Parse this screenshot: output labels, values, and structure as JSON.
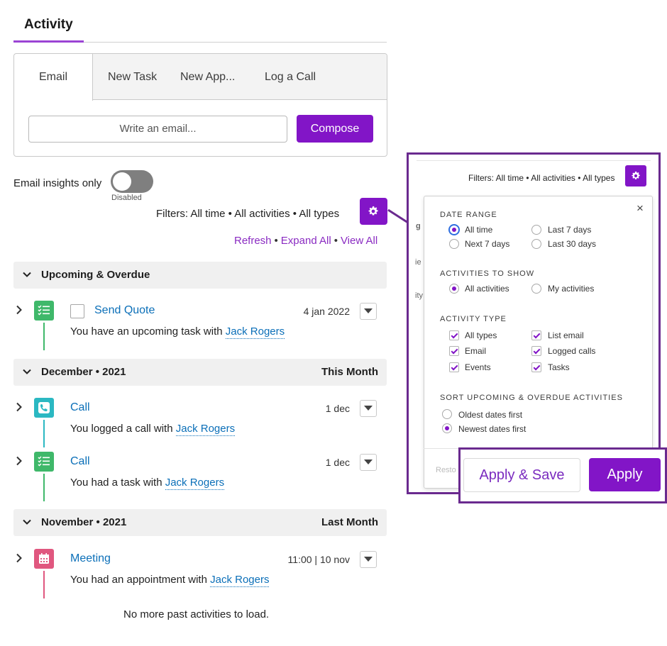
{
  "header": {
    "title": "Activity"
  },
  "composer": {
    "tabs": [
      "Email",
      "New Task",
      "New App...",
      "Log a Call"
    ],
    "input_placeholder": "Write an email...",
    "compose_label": "Compose"
  },
  "insights": {
    "label": "Email insights only",
    "state": "Disabled",
    "enabled": false
  },
  "filters": {
    "summary": "Filters: All time • All activities • All types",
    "links": [
      "Refresh",
      "Expand All",
      "View All"
    ],
    "separator": "•"
  },
  "sections": [
    {
      "title": "Upcoming & Overdue",
      "right": "",
      "items": [
        {
          "title": "Send Quote",
          "date": "4 jan 2022",
          "sub": "You have an upcoming task with",
          "contact": "Jack Rogers",
          "icon": "task-list-icon",
          "color": "#3fb86a",
          "has_checkbox": true
        }
      ]
    },
    {
      "title": "December • 2021",
      "right": "This Month",
      "items": [
        {
          "title": "Call",
          "date": "1 dec",
          "sub": "You logged a call with",
          "contact": "Jack Rogers",
          "icon": "phone-icon",
          "color": "#2bb8c2",
          "has_checkbox": false
        },
        {
          "title": "Call",
          "date": "1 dec",
          "sub": "You had a task with",
          "contact": "Jack Rogers",
          "icon": "task-list-icon",
          "color": "#3fb86a",
          "has_checkbox": false
        }
      ]
    },
    {
      "title": "November • 2021",
      "right": "Last Month",
      "items": [
        {
          "title": "Meeting",
          "date": "11:00 | 10 nov",
          "sub": "You had an appointment with",
          "contact": "Jack Rogers",
          "icon": "calendar-icon",
          "color": "#e0577f",
          "has_checkbox": false
        }
      ]
    }
  ],
  "footer": {
    "no_more": "No more past activities to load."
  },
  "panel": {
    "filters_summary": "Filters: All time • All activities • All types",
    "close": "×",
    "date_range": {
      "heading": "DATE RANGE",
      "options": [
        "All time",
        "Last 7 days",
        "Next 7 days",
        "Last 30 days"
      ],
      "selected": "All time"
    },
    "activities_to_show": {
      "heading": "ACTIVITIES TO SHOW",
      "options": [
        "All activities",
        "My activities"
      ],
      "selected": "All activities"
    },
    "activity_type": {
      "heading": "ACTIVITY TYPE",
      "options": [
        "All types",
        "List email",
        "Email",
        "Logged calls",
        "Events",
        "Tasks"
      ],
      "checked": [
        "All types",
        "List email",
        "Email",
        "Logged calls",
        "Events",
        "Tasks"
      ]
    },
    "sort": {
      "heading": "SORT UPCOMING & OVERDUE ACTIVITIES",
      "options": [
        "Oldest dates first",
        "Newest dates first"
      ],
      "selected": "Newest dates first"
    },
    "side_fragments": [
      "g",
      "ie",
      "ity"
    ],
    "restore_label": "Resto",
    "apply_save_label": "Apply & Save",
    "apply_label": "Apply"
  },
  "colors": {
    "accent": "#8215c7",
    "link": "#0b6fb8",
    "highlight_border": "#6a2a8f"
  }
}
